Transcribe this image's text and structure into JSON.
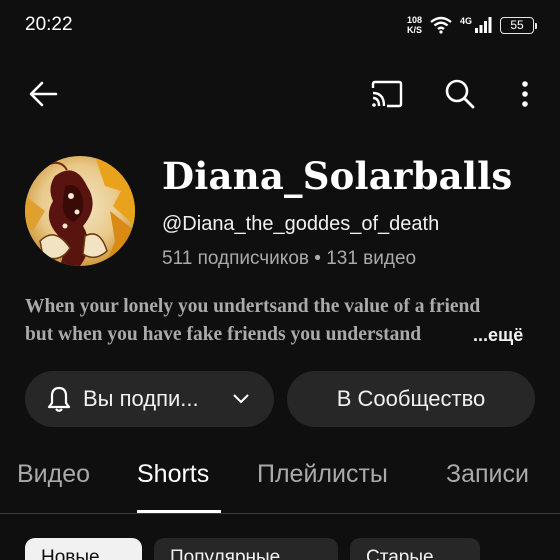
{
  "status_bar": {
    "time": "20:22",
    "net_speed_value": "108",
    "net_speed_unit": "K/S",
    "network_type": "4G",
    "battery": "55"
  },
  "top_bar": {
    "icons": [
      "back-arrow-icon",
      "cast-icon",
      "search-icon",
      "more-vert-icon"
    ]
  },
  "channel": {
    "name": "Diana_Solarballs",
    "handle": "@Diana_the_goddes_of_death",
    "stats": "511 подписчиков • 131 видео",
    "description_line1": "When your lonely you undertsand the value of a friend",
    "description_line2": "but when you have fake friends you understand",
    "more_label": "...ещё"
  },
  "actions": {
    "subscribed_label": "Вы подпи...",
    "community_label": "В Сообщество"
  },
  "tabs": {
    "videos": "Видео",
    "shorts": "Shorts",
    "playlists": "Плейлисты",
    "posts": "Записи",
    "active": "Shorts"
  },
  "chips": {
    "new": "Новые",
    "popular": "Популярные",
    "old": "Старые"
  },
  "colors": {
    "background": "#0f0f0f",
    "surface": "#272727",
    "text_primary": "#f1f1f1",
    "text_secondary": "#aaaaaa"
  }
}
